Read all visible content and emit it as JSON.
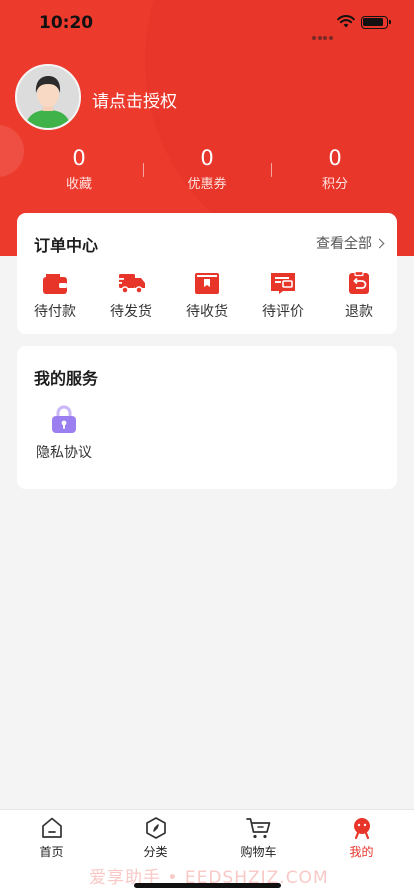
{
  "status_bar": {
    "time": "10:20"
  },
  "profile": {
    "login_prompt": "请点击授权"
  },
  "stats": [
    {
      "value": "0",
      "label": "收藏"
    },
    {
      "value": "0",
      "label": "优惠券"
    },
    {
      "value": "0",
      "label": "积分"
    }
  ],
  "orders": {
    "title": "订单中心",
    "view_all": "查看全部",
    "items": [
      {
        "label": "待付款",
        "icon": "wallet-icon"
      },
      {
        "label": "待发货",
        "icon": "truck-icon"
      },
      {
        "label": "待收货",
        "icon": "package-icon"
      },
      {
        "label": "待评价",
        "icon": "review-icon"
      },
      {
        "label": "退款",
        "icon": "refund-icon"
      }
    ]
  },
  "services": {
    "title": "我的服务",
    "items": [
      {
        "label": "隐私协议",
        "icon": "lock-icon"
      }
    ]
  },
  "tabbar": {
    "items": [
      {
        "label": "首页",
        "icon": "home-icon"
      },
      {
        "label": "分类",
        "icon": "category-icon"
      },
      {
        "label": "购物车",
        "icon": "cart-icon"
      },
      {
        "label": "我的",
        "icon": "profile-icon",
        "active": true
      }
    ]
  },
  "watermark": "爱享助手 • EEDSHZJZ.COM",
  "colors": {
    "brand": "#ec3a2d",
    "accent_icon": "#e8352a",
    "lock": "#9b7ff0",
    "page_bg": "#f4f4f4"
  }
}
